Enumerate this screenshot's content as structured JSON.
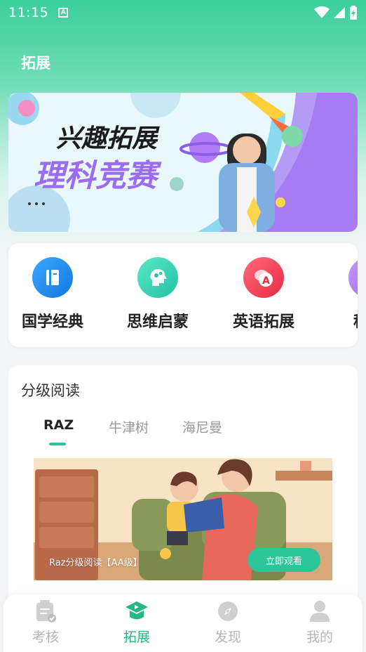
{
  "status": {
    "time": "11:15"
  },
  "header": {
    "title": "拓展"
  },
  "banner": {
    "line1": "兴趣拓展",
    "line2": "理科竞赛"
  },
  "categories": [
    {
      "label": "国学经典",
      "icon": "book-icon",
      "color": "#1e8ff0"
    },
    {
      "label": "思维启蒙",
      "icon": "brain-icon",
      "color": "#2fd3b0"
    },
    {
      "label": "英语拓展",
      "icon": "speech-a-icon",
      "color": "#f0455a"
    },
    {
      "label": "科学",
      "icon": "science-icon",
      "color": "#a77bf3"
    }
  ],
  "reading": {
    "title": "分级阅读",
    "tabs": [
      {
        "label": "RAZ",
        "active": true
      },
      {
        "label": "牛津树",
        "active": false
      },
      {
        "label": "海尼曼",
        "active": false
      }
    ],
    "caption": "Raz分级阅读【AA级】",
    "watch_label": "立即观看"
  },
  "nav": [
    {
      "label": "考核",
      "icon": "clipboard-icon",
      "active": false
    },
    {
      "label": "拓展",
      "icon": "graduation-play-icon",
      "active": true
    },
    {
      "label": "发现",
      "icon": "compass-icon",
      "active": false
    },
    {
      "label": "我的",
      "icon": "user-icon",
      "active": false
    }
  ],
  "colors": {
    "accent": "#2cc597",
    "header_green": "#3bcf9a"
  }
}
